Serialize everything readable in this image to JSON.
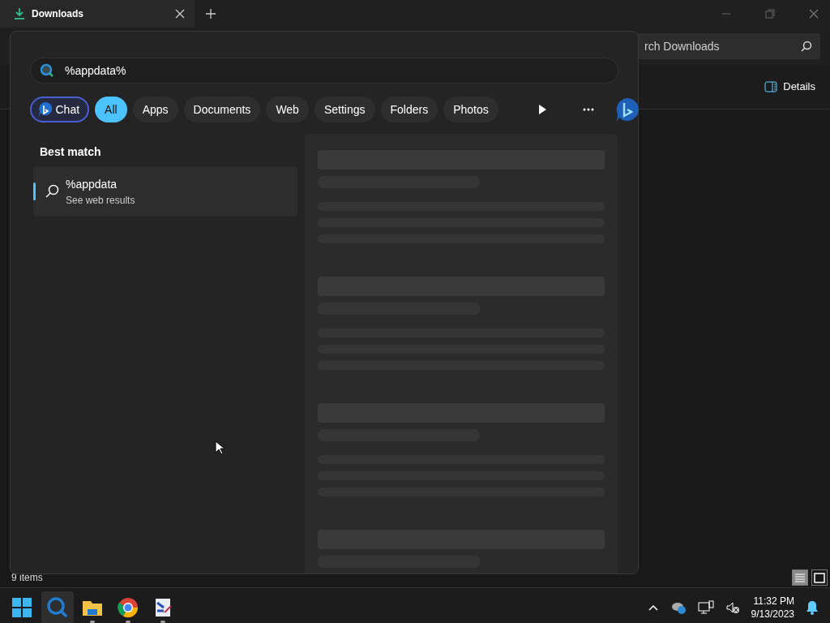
{
  "explorer": {
    "tab_title": "Downloads",
    "search": {
      "placeholder": "rch Downloads"
    },
    "details_button": "Details",
    "status": "9 items",
    "views": [
      {
        "selected": true
      },
      {
        "selected": false
      }
    ]
  },
  "search_panel": {
    "query": "%appdata%",
    "filters": [
      {
        "label": "Chat",
        "kind": "chat",
        "selected": false
      },
      {
        "label": "All",
        "kind": "filter",
        "selected": true
      },
      {
        "label": "Apps",
        "kind": "filter",
        "selected": false
      },
      {
        "label": "Documents",
        "kind": "filter",
        "selected": false
      },
      {
        "label": "Web",
        "kind": "filter",
        "selected": false
      },
      {
        "label": "Settings",
        "kind": "filter",
        "selected": false
      },
      {
        "label": "Folders",
        "kind": "filter",
        "selected": false
      },
      {
        "label": "Photos",
        "kind": "filter",
        "selected": false
      }
    ],
    "section_title": "Best match",
    "results": [
      {
        "title": "%appdata",
        "subtitle": "See web results",
        "selected": true
      }
    ]
  },
  "taskbar": {
    "apps": [
      {
        "kind": "start",
        "running": false,
        "selected": false
      },
      {
        "kind": "search",
        "running": false,
        "selected": true
      },
      {
        "kind": "folder",
        "running": true,
        "selected": false
      },
      {
        "kind": "browser",
        "running": true,
        "selected": false
      },
      {
        "kind": "tool",
        "running": true,
        "selected": false
      }
    ],
    "time": "11:32 PM",
    "date": "9/13/2023"
  }
}
